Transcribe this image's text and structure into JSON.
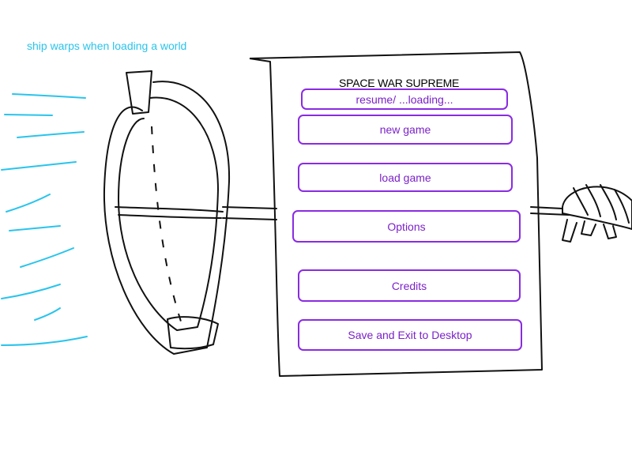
{
  "annotation": "ship warps when loading a world",
  "menu": {
    "title": "SPACE WAR SUPREME",
    "buttons": {
      "resume": "resume/ ...loading...",
      "new_game": "new game",
      "load_game": "load game",
      "options": "Options",
      "credits": "Credits",
      "exit": "Save and Exit to Desktop"
    }
  },
  "colors": {
    "annotation": "#29c4ec",
    "button_border": "#8a2be2",
    "button_text": "#7b22c8",
    "sketch_line": "#111111"
  }
}
